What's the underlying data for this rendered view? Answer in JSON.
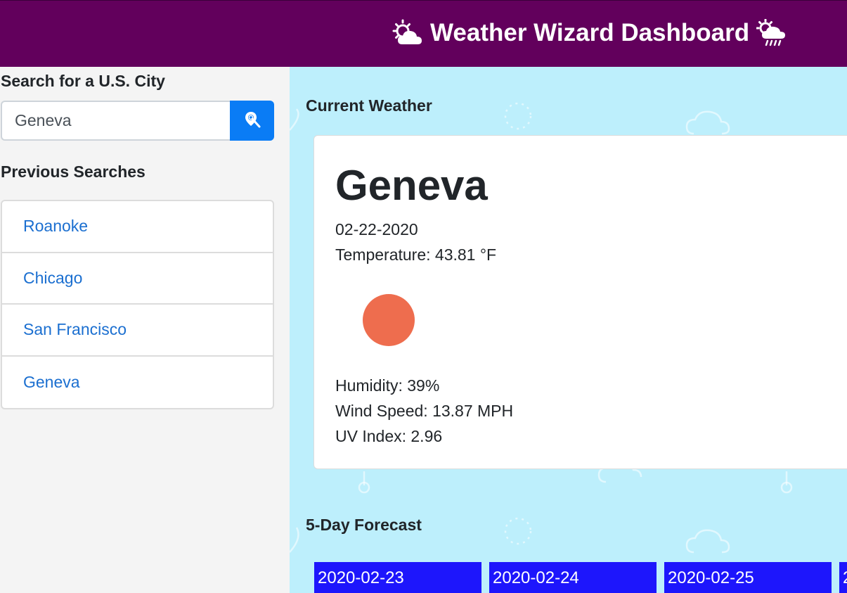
{
  "header": {
    "title": "Weather Wizard Dashboard",
    "left_icon": "sun-behind-cloud-icon",
    "right_icon": "sun-rain-cloud-icon"
  },
  "sidebar": {
    "search_label": "Search for a U.S. City",
    "search_value": "Geneva",
    "search_button_icon": "location-search-icon",
    "previous_label": "Previous Searches",
    "previous_searches": [
      "Roanoke",
      "Chicago",
      "San Francisco",
      "Geneva"
    ]
  },
  "current": {
    "section_title": "Current Weather",
    "city": "Geneva",
    "date": "02-22-2020",
    "temperature": "Temperature: 43.81 °F",
    "icon": "clear-sun-icon",
    "humidity": "Humidity: 39%",
    "wind": "Wind Speed: 13.87 MPH",
    "uv": "UV Index: 2.96"
  },
  "forecast": {
    "section_title": "5-Day Forecast",
    "days": [
      {
        "date": "2020-02-23"
      },
      {
        "date": "2020-02-24"
      },
      {
        "date": "2020-02-25"
      },
      {
        "date": "2"
      }
    ]
  },
  "colors": {
    "header_bg": "#62005c",
    "main_bg": "#bdeffc",
    "accent_button": "#0a7cf5",
    "link": "#1b6fd0",
    "sun": "#ee6d4e",
    "forecast_card": "#1d16fc"
  }
}
